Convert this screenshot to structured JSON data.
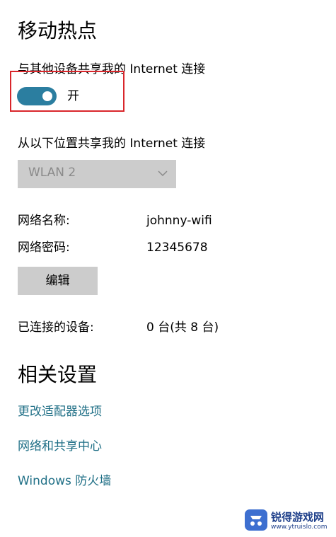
{
  "hotspot": {
    "title": "移动热点",
    "share_label": "与其他设备共享我的 Internet 连接",
    "toggle_state": "开",
    "toggle_on": true,
    "source_label": "从以下位置共享我的 Internet 连接",
    "source_selected": "WLAN 2",
    "network_name_label": "网络名称:",
    "network_name_value": "johnny-wifi",
    "network_password_label": "网络密码:",
    "network_password_value": "12345678",
    "edit_button": "编辑",
    "connected_label": "已连接的设备:",
    "connected_value": "0 台(共 8 台)"
  },
  "related": {
    "title": "相关设置",
    "links": [
      "更改适配器选项",
      "网络和共享中心",
      "Windows 防火墙"
    ]
  },
  "colors": {
    "accent": "#2b7ea0",
    "link": "#1f6f86",
    "highlight": "#d9262b",
    "control_bg": "#cccccc"
  },
  "watermark": {
    "brand": "锐得游戏网",
    "url": "www.ytruislo.com"
  }
}
